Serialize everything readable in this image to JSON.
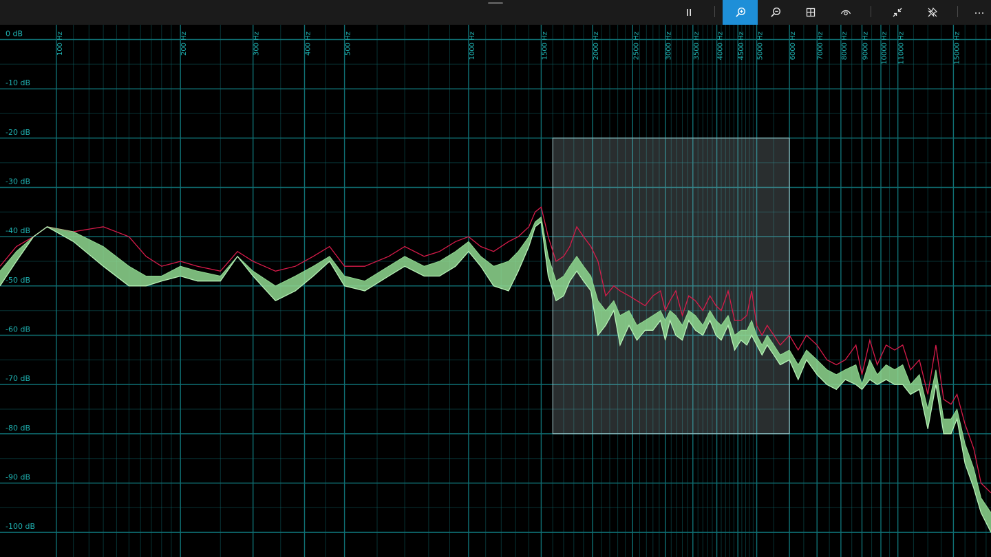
{
  "toolbar": {
    "buttons": [
      {
        "name": "pause-button",
        "icon": "pause-icon",
        "active": false
      },
      {
        "name": "zoom-in-button",
        "icon": "zoom-in-icon",
        "active": true
      },
      {
        "name": "zoom-out-button",
        "icon": "zoom-out-icon",
        "active": false
      },
      {
        "name": "grid-button",
        "icon": "grid-icon",
        "active": false
      },
      {
        "name": "view-button",
        "icon": "eye-icon",
        "active": false
      },
      {
        "name": "collapse-button",
        "icon": "collapse-icon",
        "active": false
      },
      {
        "name": "unpin-button",
        "icon": "unpin-icon",
        "active": false
      },
      {
        "name": "more-button",
        "icon": "more-icon",
        "active": false
      }
    ],
    "accent_color": "#1e8fd8"
  },
  "chart_data": {
    "type": "line",
    "x_scale": "log",
    "y_scale": "linear",
    "grid": true,
    "grid_color": "#0f6f73",
    "label_color": "#1fb3b3",
    "xlim": [
      73,
      18500
    ],
    "ylim": [
      -105,
      3
    ],
    "x_tick_values": [
      100,
      200,
      300,
      400,
      500,
      1000,
      1500,
      2000,
      2500,
      3000,
      3500,
      4000,
      4500,
      5000,
      6000,
      7000,
      8000,
      9000,
      10000,
      11000,
      15000
    ],
    "x_tick_labels": [
      "100 Hz",
      "200 Hz",
      "300 Hz",
      "400 Hz",
      "500 Hz",
      "1000 Hz",
      "1500 Hz",
      "2000 Hz",
      "2500 Hz",
      "3000 Hz",
      "3500 Hz",
      "4000 Hz",
      "4500 Hz",
      "5000 Hz",
      "6000 Hz",
      "7000 Hz",
      "8000 Hz",
      "9000 Hz",
      "10000 Hz",
      "11000 Hz",
      "15000 Hz"
    ],
    "y_tick_values": [
      0,
      -10,
      -20,
      -30,
      -40,
      -50,
      -60,
      -70,
      -80,
      -90,
      -100
    ],
    "y_tick_labels": [
      "0 dB",
      "-10 dB",
      "-20 dB",
      "-30 dB",
      "-40 dB",
      "-50 dB",
      "-60 dB",
      "-70 dB",
      "-80 dB",
      "-90 dB",
      "-100 dB"
    ],
    "series": [
      {
        "role": "peak",
        "color": "#d81b4a",
        "points": [
          [
            73,
            -46
          ],
          [
            80,
            -42
          ],
          [
            88,
            -40
          ],
          [
            95,
            -38
          ],
          [
            110,
            -39
          ],
          [
            130,
            -38
          ],
          [
            150,
            -40
          ],
          [
            165,
            -44
          ],
          [
            180,
            -46
          ],
          [
            200,
            -45
          ],
          [
            220,
            -46
          ],
          [
            250,
            -47
          ],
          [
            275,
            -43
          ],
          [
            300,
            -45
          ],
          [
            340,
            -47
          ],
          [
            380,
            -46
          ],
          [
            420,
            -44
          ],
          [
            460,
            -42
          ],
          [
            500,
            -46
          ],
          [
            560,
            -46
          ],
          [
            640,
            -44
          ],
          [
            700,
            -42
          ],
          [
            780,
            -44
          ],
          [
            850,
            -43
          ],
          [
            930,
            -41
          ],
          [
            1000,
            -40
          ],
          [
            1070,
            -42
          ],
          [
            1150,
            -43
          ],
          [
            1250,
            -41
          ],
          [
            1320,
            -40
          ],
          [
            1400,
            -38
          ],
          [
            1450,
            -35
          ],
          [
            1500,
            -34
          ],
          [
            1560,
            -40
          ],
          [
            1630,
            -45
          ],
          [
            1700,
            -44
          ],
          [
            1760,
            -42
          ],
          [
            1830,
            -38
          ],
          [
            1900,
            -40
          ],
          [
            1980,
            -42
          ],
          [
            2060,
            -45
          ],
          [
            2150,
            -52
          ],
          [
            2250,
            -50
          ],
          [
            2330,
            -51
          ],
          [
            2450,
            -52
          ],
          [
            2560,
            -53
          ],
          [
            2680,
            -54
          ],
          [
            2800,
            -52
          ],
          [
            2920,
            -51
          ],
          [
            3000,
            -55
          ],
          [
            3080,
            -53
          ],
          [
            3180,
            -51
          ],
          [
            3300,
            -56
          ],
          [
            3420,
            -52
          ],
          [
            3550,
            -53
          ],
          [
            3700,
            -55
          ],
          [
            3850,
            -52
          ],
          [
            3980,
            -54
          ],
          [
            4100,
            -55
          ],
          [
            4260,
            -51
          ],
          [
            4420,
            -57
          ],
          [
            4580,
            -57
          ],
          [
            4730,
            -56
          ],
          [
            4860,
            -51
          ],
          [
            5000,
            -58
          ],
          [
            5150,
            -60
          ],
          [
            5300,
            -58
          ],
          [
            5500,
            -60
          ],
          [
            5700,
            -62
          ],
          [
            6000,
            -60
          ],
          [
            6300,
            -63
          ],
          [
            6600,
            -60
          ],
          [
            7000,
            -62
          ],
          [
            7400,
            -65
          ],
          [
            7800,
            -66
          ],
          [
            8200,
            -65
          ],
          [
            8700,
            -62
          ],
          [
            9000,
            -68
          ],
          [
            9400,
            -61
          ],
          [
            9800,
            -66
          ],
          [
            10300,
            -62
          ],
          [
            10800,
            -63
          ],
          [
            11300,
            -62
          ],
          [
            11800,
            -67
          ],
          [
            12400,
            -65
          ],
          [
            13000,
            -72
          ],
          [
            13600,
            -62
          ],
          [
            14200,
            -73
          ],
          [
            14800,
            -74
          ],
          [
            15300,
            -72
          ],
          [
            16000,
            -78
          ],
          [
            16800,
            -83
          ],
          [
            17500,
            -90
          ],
          [
            18500,
            -92
          ]
        ]
      },
      {
        "role": "average",
        "color": "#8fd88f",
        "points": [
          [
            73,
            -47
          ],
          [
            80,
            -43
          ],
          [
            88,
            -40
          ],
          [
            95,
            -38
          ],
          [
            110,
            -39
          ],
          [
            130,
            -42
          ],
          [
            150,
            -46
          ],
          [
            165,
            -48
          ],
          [
            180,
            -48
          ],
          [
            200,
            -46
          ],
          [
            220,
            -47
          ],
          [
            250,
            -48
          ],
          [
            275,
            -44
          ],
          [
            300,
            -47
          ],
          [
            340,
            -50
          ],
          [
            380,
            -48
          ],
          [
            420,
            -46
          ],
          [
            460,
            -44
          ],
          [
            500,
            -48
          ],
          [
            560,
            -49
          ],
          [
            640,
            -46
          ],
          [
            700,
            -44
          ],
          [
            780,
            -46
          ],
          [
            850,
            -45
          ],
          [
            930,
            -43
          ],
          [
            1000,
            -41
          ],
          [
            1070,
            -44
          ],
          [
            1150,
            -46
          ],
          [
            1250,
            -45
          ],
          [
            1320,
            -43
          ],
          [
            1400,
            -40
          ],
          [
            1450,
            -37
          ],
          [
            1500,
            -36
          ],
          [
            1560,
            -44
          ],
          [
            1630,
            -49
          ],
          [
            1700,
            -48
          ],
          [
            1760,
            -46
          ],
          [
            1830,
            -44
          ],
          [
            1900,
            -46
          ],
          [
            1980,
            -48
          ],
          [
            2060,
            -53
          ],
          [
            2150,
            -55
          ],
          [
            2250,
            -53
          ],
          [
            2330,
            -56
          ],
          [
            2450,
            -55
          ],
          [
            2560,
            -58
          ],
          [
            2680,
            -57
          ],
          [
            2800,
            -56
          ],
          [
            2920,
            -55
          ],
          [
            3000,
            -57
          ],
          [
            3080,
            -55
          ],
          [
            3180,
            -56
          ],
          [
            3300,
            -58
          ],
          [
            3420,
            -55
          ],
          [
            3550,
            -56
          ],
          [
            3700,
            -58
          ],
          [
            3850,
            -55
          ],
          [
            3980,
            -57
          ],
          [
            4100,
            -58
          ],
          [
            4260,
            -56
          ],
          [
            4420,
            -60
          ],
          [
            4580,
            -59
          ],
          [
            4730,
            -59
          ],
          [
            4860,
            -57
          ],
          [
            5000,
            -60
          ],
          [
            5150,
            -62
          ],
          [
            5300,
            -60
          ],
          [
            5500,
            -62
          ],
          [
            5700,
            -64
          ],
          [
            6000,
            -63
          ],
          [
            6300,
            -66
          ],
          [
            6600,
            -63
          ],
          [
            7000,
            -65
          ],
          [
            7400,
            -67
          ],
          [
            7800,
            -68
          ],
          [
            8200,
            -67
          ],
          [
            8700,
            -66
          ],
          [
            9000,
            -70
          ],
          [
            9400,
            -65
          ],
          [
            9800,
            -68
          ],
          [
            10300,
            -66
          ],
          [
            10800,
            -67
          ],
          [
            11300,
            -66
          ],
          [
            11800,
            -70
          ],
          [
            12400,
            -68
          ],
          [
            13000,
            -75
          ],
          [
            13600,
            -67
          ],
          [
            14200,
            -77
          ],
          [
            14800,
            -77
          ],
          [
            15300,
            -75
          ],
          [
            16000,
            -82
          ],
          [
            16800,
            -87
          ],
          [
            17500,
            -93
          ],
          [
            18500,
            -96
          ]
        ]
      },
      {
        "role": "current",
        "color": "#b6f0b6",
        "points": [
          [
            73,
            -50
          ],
          [
            80,
            -45
          ],
          [
            88,
            -40
          ],
          [
            95,
            -38
          ],
          [
            110,
            -41
          ],
          [
            130,
            -46
          ],
          [
            150,
            -50
          ],
          [
            165,
            -50
          ],
          [
            180,
            -49
          ],
          [
            200,
            -48
          ],
          [
            220,
            -49
          ],
          [
            250,
            -49
          ],
          [
            275,
            -44
          ],
          [
            300,
            -48
          ],
          [
            340,
            -53
          ],
          [
            380,
            -51
          ],
          [
            420,
            -48
          ],
          [
            460,
            -45
          ],
          [
            500,
            -50
          ],
          [
            560,
            -51
          ],
          [
            640,
            -48
          ],
          [
            700,
            -46
          ],
          [
            780,
            -48
          ],
          [
            850,
            -48
          ],
          [
            930,
            -46
          ],
          [
            1000,
            -43
          ],
          [
            1070,
            -46
          ],
          [
            1150,
            -50
          ],
          [
            1250,
            -51
          ],
          [
            1320,
            -47
          ],
          [
            1400,
            -42
          ],
          [
            1450,
            -38
          ],
          [
            1500,
            -37
          ],
          [
            1560,
            -48
          ],
          [
            1630,
            -53
          ],
          [
            1700,
            -52
          ],
          [
            1760,
            -49
          ],
          [
            1830,
            -47
          ],
          [
            1900,
            -49
          ],
          [
            1980,
            -51
          ],
          [
            2060,
            -60
          ],
          [
            2150,
            -58
          ],
          [
            2250,
            -55
          ],
          [
            2330,
            -62
          ],
          [
            2450,
            -58
          ],
          [
            2560,
            -61
          ],
          [
            2680,
            -59
          ],
          [
            2800,
            -59
          ],
          [
            2920,
            -57
          ],
          [
            3000,
            -61
          ],
          [
            3080,
            -57
          ],
          [
            3180,
            -60
          ],
          [
            3300,
            -61
          ],
          [
            3420,
            -57
          ],
          [
            3550,
            -59
          ],
          [
            3700,
            -60
          ],
          [
            3850,
            -57
          ],
          [
            3980,
            -60
          ],
          [
            4100,
            -61
          ],
          [
            4260,
            -58
          ],
          [
            4420,
            -63
          ],
          [
            4580,
            -61
          ],
          [
            4730,
            -62
          ],
          [
            4860,
            -60
          ],
          [
            5000,
            -62
          ],
          [
            5150,
            -64
          ],
          [
            5300,
            -62
          ],
          [
            5500,
            -64
          ],
          [
            5700,
            -66
          ],
          [
            6000,
            -65
          ],
          [
            6300,
            -69
          ],
          [
            6600,
            -65
          ],
          [
            7000,
            -68
          ],
          [
            7400,
            -70
          ],
          [
            7800,
            -71
          ],
          [
            8200,
            -69
          ],
          [
            8700,
            -70
          ],
          [
            9000,
            -71
          ],
          [
            9400,
            -69
          ],
          [
            9800,
            -70
          ],
          [
            10300,
            -69
          ],
          [
            10800,
            -70
          ],
          [
            11300,
            -70
          ],
          [
            11800,
            -72
          ],
          [
            12400,
            -71
          ],
          [
            13000,
            -79
          ],
          [
            13600,
            -70
          ],
          [
            14200,
            -80
          ],
          [
            14800,
            -80
          ],
          [
            15300,
            -77
          ],
          [
            16000,
            -86
          ],
          [
            16800,
            -91
          ],
          [
            17500,
            -96
          ],
          [
            18500,
            -100
          ]
        ]
      }
    ],
    "selection": {
      "x": [
        1600,
        6000
      ],
      "y": [
        -80,
        -20
      ],
      "color": "#cfe6ea"
    }
  }
}
